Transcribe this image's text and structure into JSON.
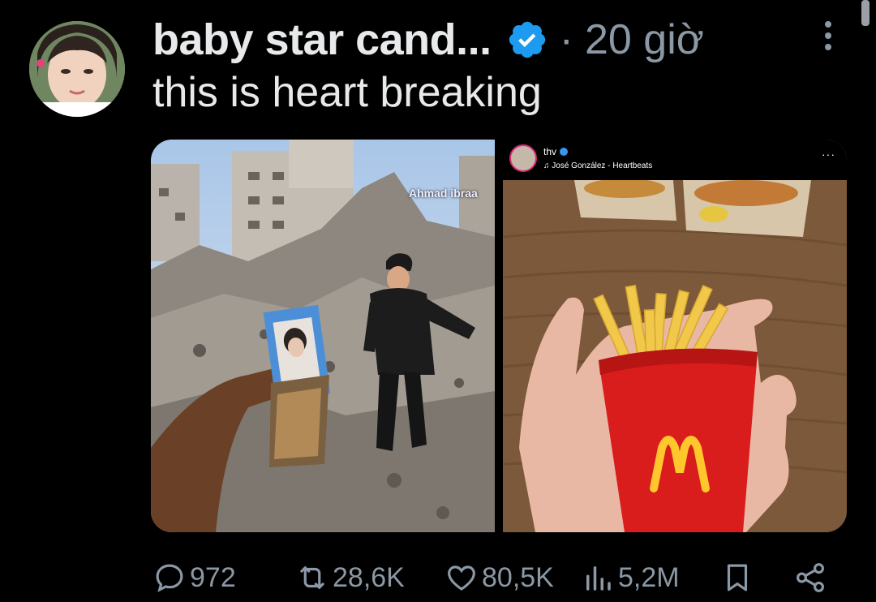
{
  "tweet": {
    "author_name": "baby star cand...",
    "verified_icon": "verified-badge-icon",
    "separator": "·",
    "time_ago": "20 giờ",
    "text": "this is heart breaking",
    "more_icon": "more-vertical-icon"
  },
  "media": {
    "left": {
      "watermark": "Ahmad ibraa"
    },
    "right": {
      "ig_username": "thv",
      "ig_song": "José González - Heartbeats",
      "ig_more": "···"
    }
  },
  "actions": {
    "reply_count": "972",
    "retweet_count": "28,6K",
    "like_count": "80,5K",
    "views_count": "5,2M"
  },
  "colors": {
    "background": "#000000",
    "text": "#e7e9ea",
    "secondary": "#8b98a5",
    "verified": "#1d9bf0"
  }
}
